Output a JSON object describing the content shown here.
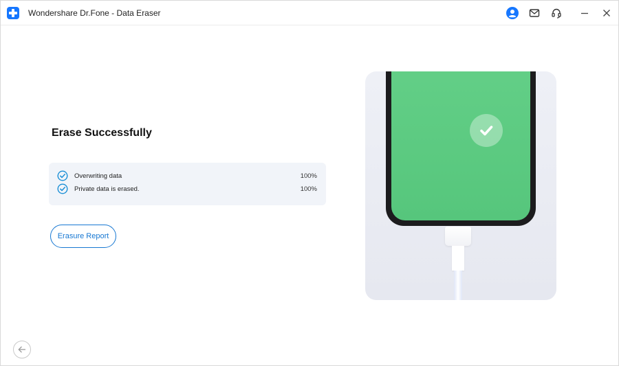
{
  "window": {
    "title": "Wondershare Dr.Fone - Data Eraser"
  },
  "titlebar_icons": {
    "user": "user-avatar-icon",
    "mail": "mail-icon",
    "support": "headset-icon",
    "minimize": "minimize-icon",
    "close": "close-icon"
  },
  "main": {
    "headline": "Erase Successfully",
    "progress": [
      {
        "label": "Overwriting data",
        "percent_text": "100%",
        "percent": 100
      },
      {
        "label": "Private data is erased.",
        "percent_text": "100%",
        "percent": 100
      }
    ],
    "report_button": "Erasure Report"
  },
  "colors": {
    "accent": "#1677d2",
    "success_green": "#5ecb83",
    "check_blue": "#1a8fd6",
    "progress_bg": "#f1f4f9"
  }
}
